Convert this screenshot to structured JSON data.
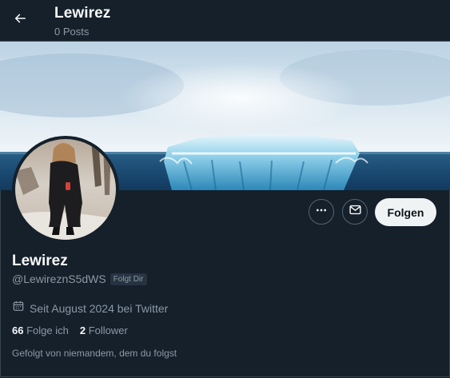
{
  "header": {
    "name": "Lewirez",
    "posts": "0 Posts",
    "back_icon": "arrow-left-icon"
  },
  "profile": {
    "display_name": "Lewirez",
    "handle": "@LewireznS5dWS",
    "follows_you_badge": "Folgt Dir",
    "joined": "Seit August 2024 bei Twitter",
    "following_count": "66",
    "following_label": "Folge ich",
    "followers_count": "2",
    "followers_label": "Follower",
    "followed_by": "Gefolgt von niemandem, dem du folgst"
  },
  "actions": {
    "more_icon": "more-horizontal-icon",
    "message_icon": "envelope-icon",
    "follow_label": "Folgen"
  },
  "colors": {
    "background": "#15202b",
    "text_primary": "#f7f9f9",
    "text_secondary": "#8b98a5",
    "follow_button": "#eff3f4"
  }
}
